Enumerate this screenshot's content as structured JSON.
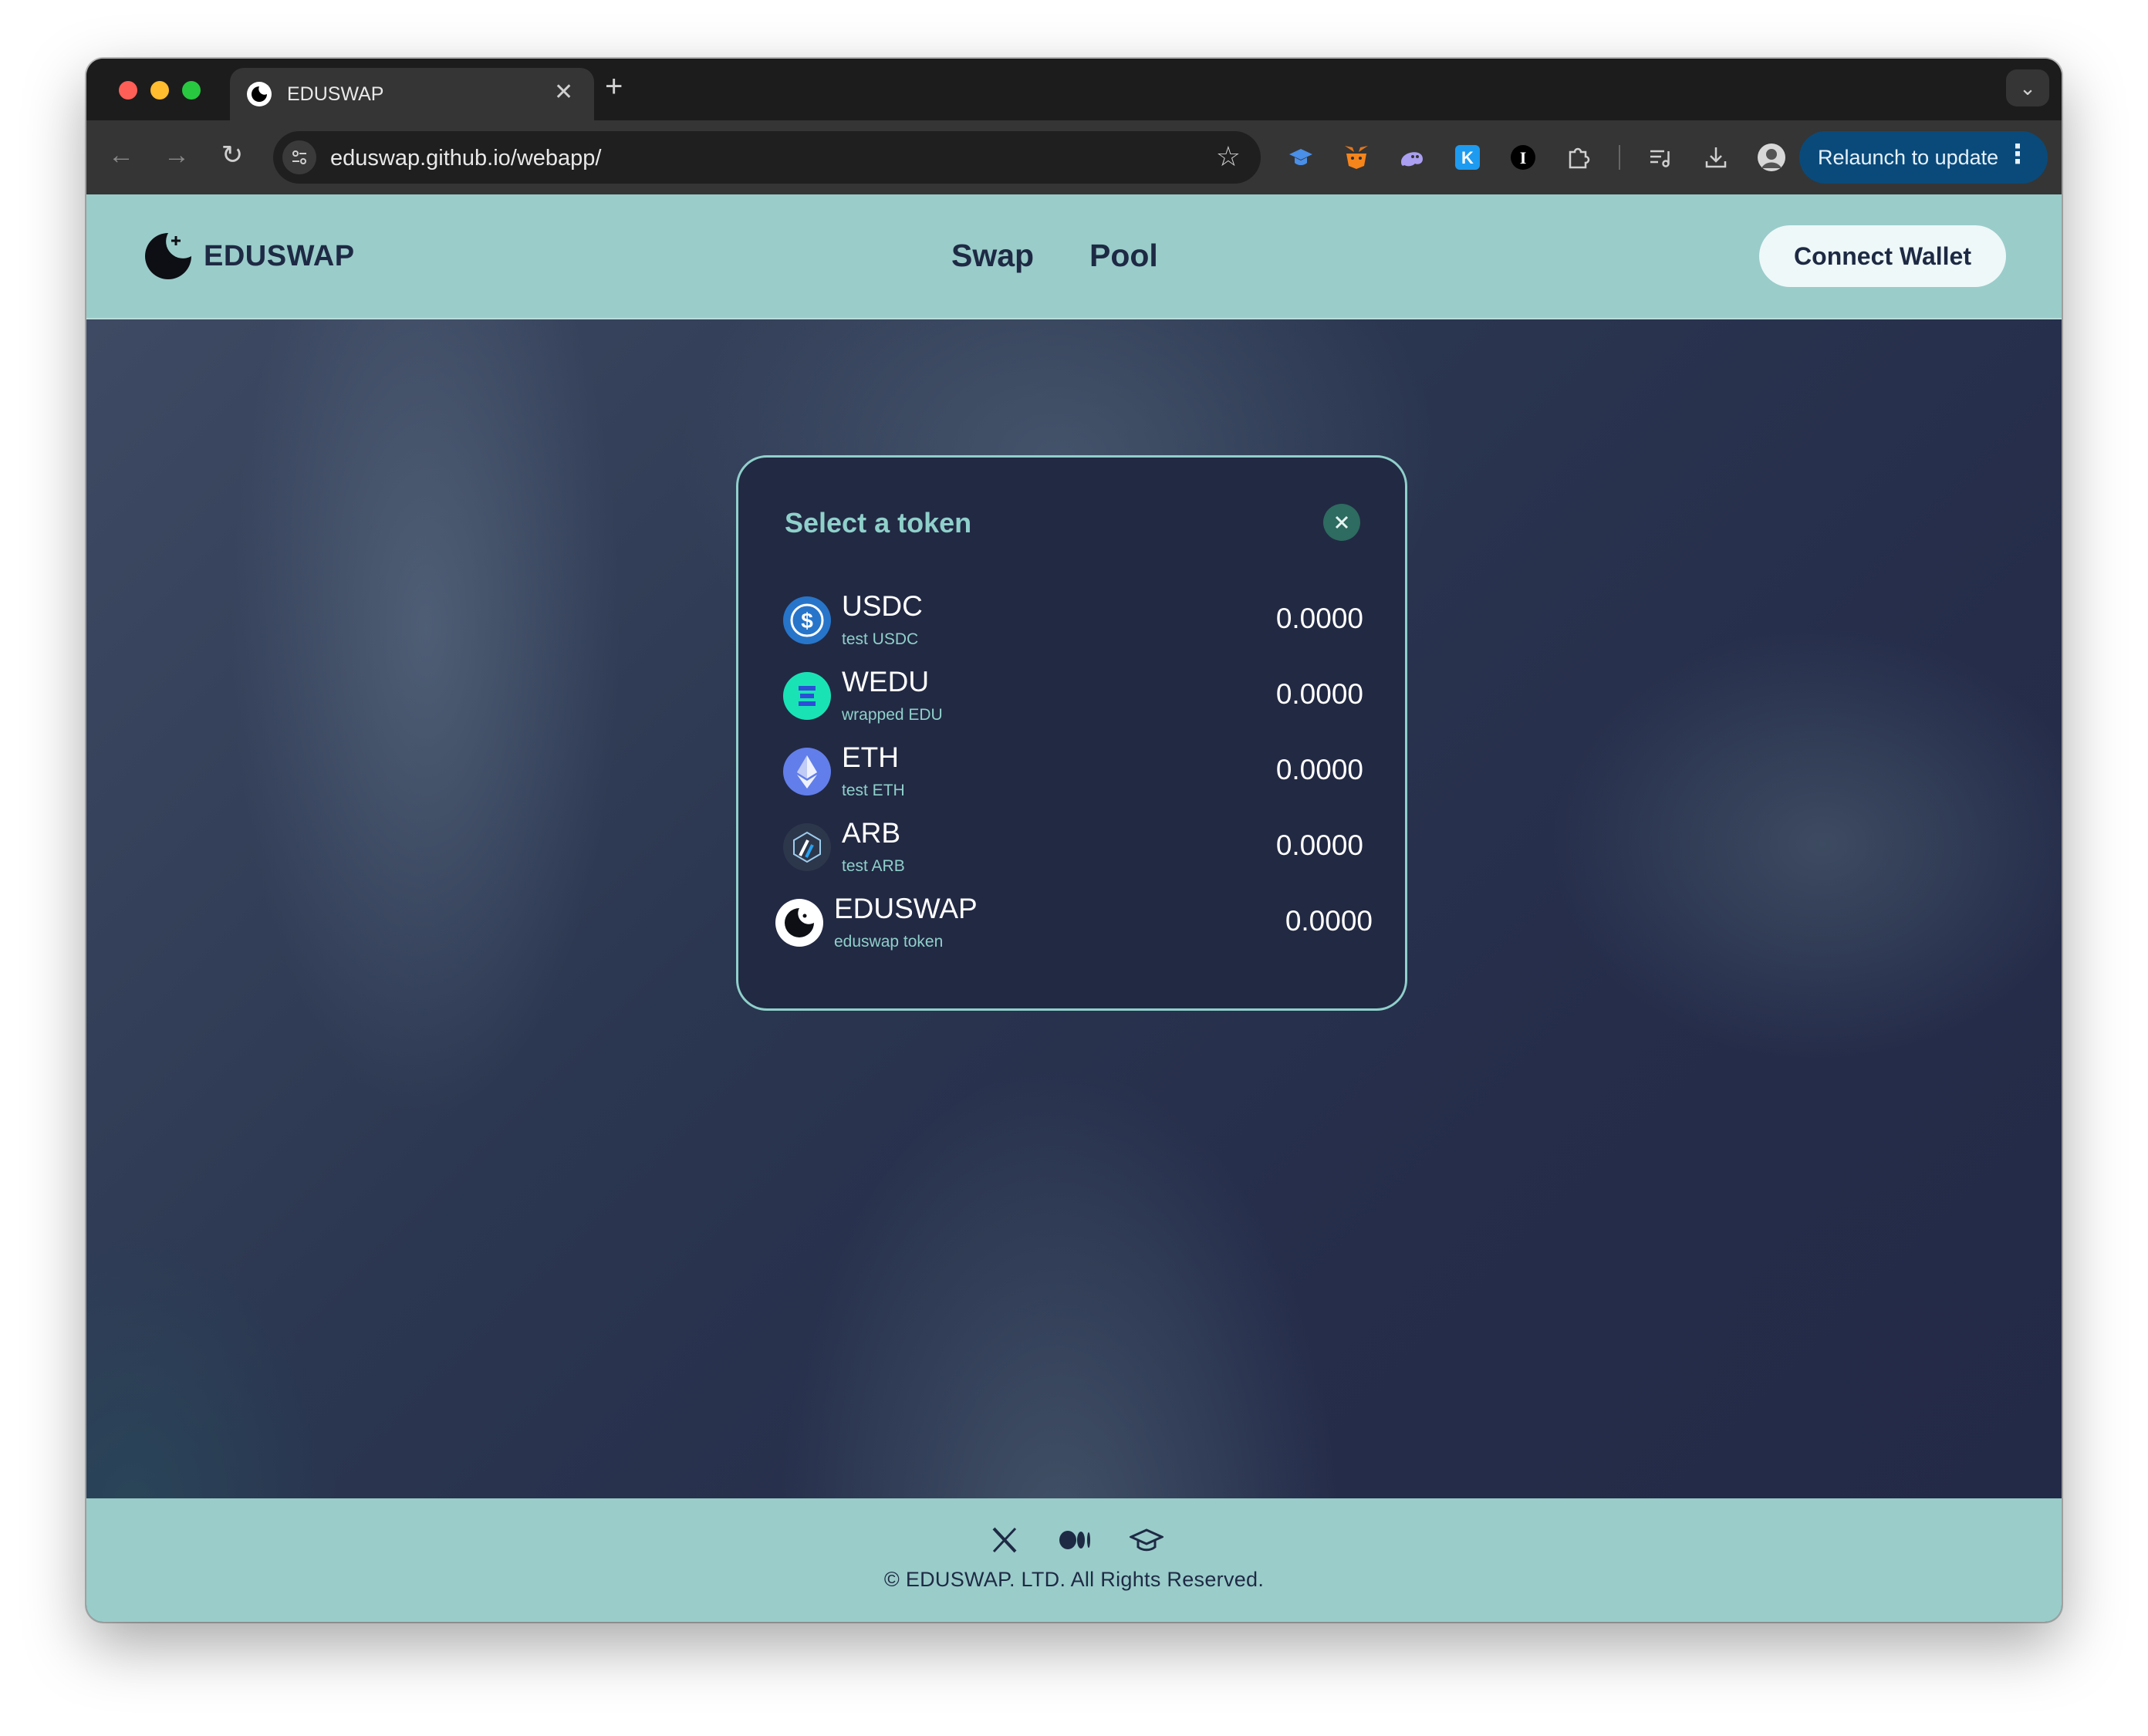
{
  "browser": {
    "tab_title": "EDUSWAP",
    "tab_close": "✕",
    "new_tab": "+",
    "tab_menu": "⌄",
    "url": "eduswap.github.io/webapp/",
    "relaunch_label": "Relaunch to update",
    "relaunch_more": "⋮",
    "extensions": [
      "graduation-cap-extension-icon",
      "metamask-fox-icon",
      "ghost-wallet-icon",
      "k-extension-icon",
      "i-extension-icon",
      "puzzle-extensions-icon",
      "media-control-icon",
      "download-icon",
      "profile-avatar-icon"
    ]
  },
  "site": {
    "logo_text": "EDUSWAP",
    "nav": {
      "swap": "Swap",
      "pool": "Pool"
    },
    "connect_wallet": "Connect Wallet",
    "copyright": "© EDUSWAP. LTD. All Rights Reserved."
  },
  "modal": {
    "title": "Select a token",
    "tokens": [
      {
        "symbol": "USDC",
        "name": "test USDC",
        "balance": "0.0000",
        "icon": "usdc-icon",
        "color": "#2775ca"
      },
      {
        "symbol": "WEDU",
        "name": "wrapped EDU",
        "balance": "0.0000",
        "icon": "wedu-icon",
        "color": "#19e3b5"
      },
      {
        "symbol": "ETH",
        "name": "test ETH",
        "balance": "0.0000",
        "icon": "eth-icon",
        "color": "#627eea"
      },
      {
        "symbol": "ARB",
        "name": "test ARB",
        "balance": "0.0000",
        "icon": "arb-icon",
        "color": "#2d374b"
      },
      {
        "symbol": "EDUSWAP",
        "name": "eduswap token",
        "balance": "0.0000",
        "icon": "eduswap-icon",
        "color": "#ffffff"
      }
    ]
  },
  "colors": {
    "header_bg": "#9accca",
    "accent": "#8fd0cb",
    "modal_bg": "#222943",
    "text_dark": "#1e2a44",
    "close_button": "#2e6b60",
    "relaunch_bg": "#0a4a7a"
  }
}
